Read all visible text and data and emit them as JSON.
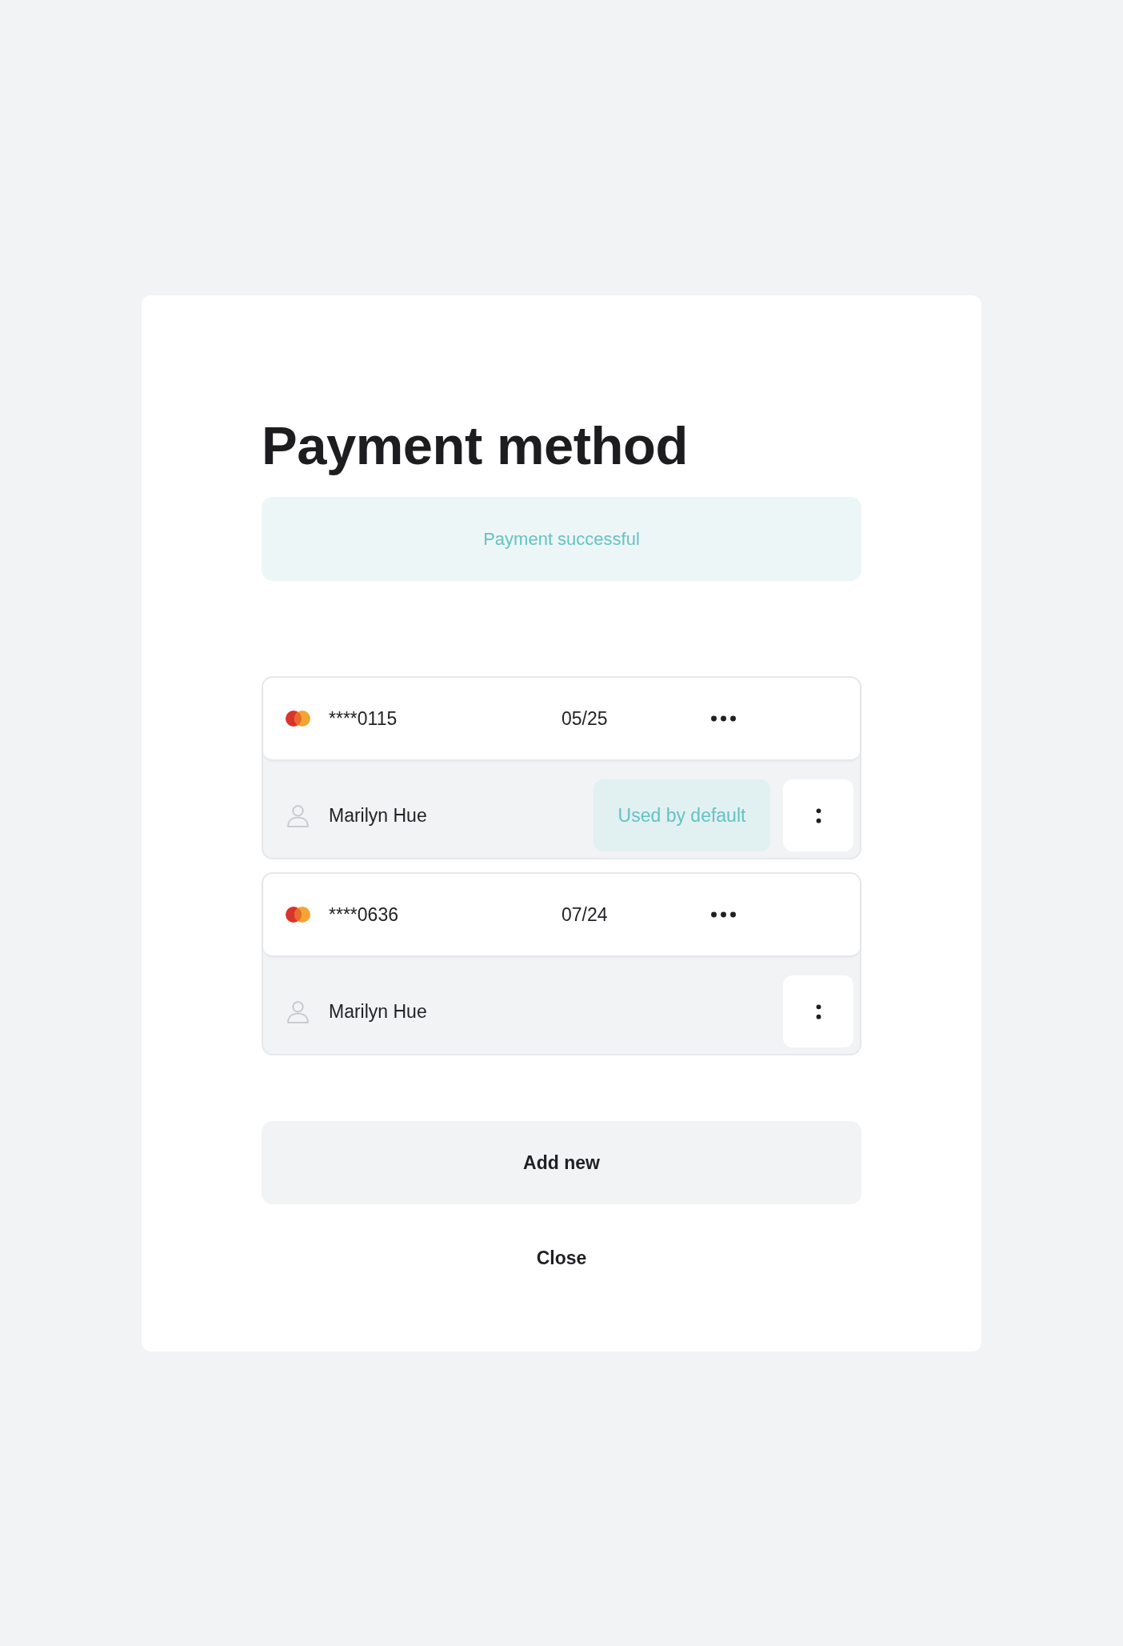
{
  "dialog": {
    "title": "Payment method"
  },
  "alert": {
    "text": "Payment successful"
  },
  "cards": [
    {
      "number": "****0115",
      "expiry": "05/25",
      "holder": "Marilyn Hue",
      "badge": "Used by default"
    },
    {
      "number": "****0636",
      "expiry": "07/24",
      "holder": "Marilyn Hue"
    }
  ],
  "buttons": [
    {
      "label": "Add new",
      "kind": "secondary"
    },
    {
      "label": "Close",
      "kind": "text"
    }
  ]
}
